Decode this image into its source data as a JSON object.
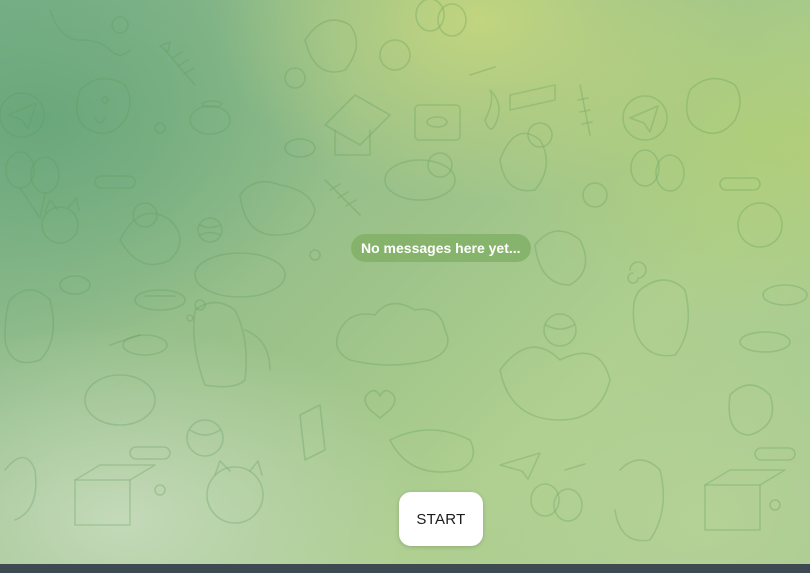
{
  "chat": {
    "empty_state_text": "No messages here yet...",
    "start_button_label": "START"
  },
  "background": {
    "pattern": "doodle-pattern-cats-dogs-fish-balloons",
    "gradient_colors": [
      "#7fb38c",
      "#9cc28a",
      "#c4d67e",
      "#aecf8f",
      "#c8dcbe"
    ],
    "doodle_color": "#5e9a5a"
  },
  "pill_color": "#82b066",
  "button_color": "#ffffff"
}
